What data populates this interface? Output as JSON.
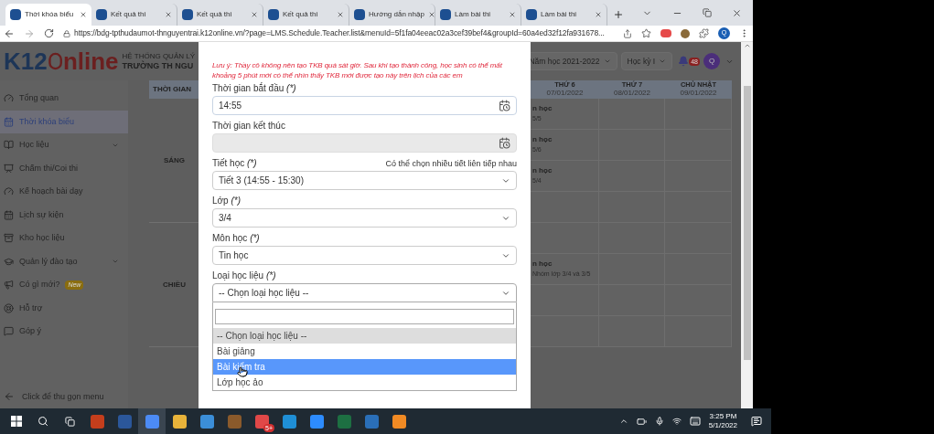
{
  "browser": {
    "tabs": [
      {
        "title": "Thời khóa biểu",
        "selected": true
      },
      {
        "title": "Kết quả thi",
        "selected": false
      },
      {
        "title": "Kết quả thi",
        "selected": false
      },
      {
        "title": "Kết quả thi",
        "selected": false
      },
      {
        "title": "Hướng dẫn nhập",
        "selected": false
      },
      {
        "title": "Làm bài thi",
        "selected": false
      },
      {
        "title": "Làm bài thi",
        "selected": false
      }
    ],
    "url": "https://bdg-tpthudaumot-thnguyentrai.k12online.vn/?page=LMS.Schedule.Teacher.list&menuId=5f1fa04eeac02a3cef39bef4&groupId=60a4ed32f12fa931678...",
    "profile": "Q"
  },
  "header": {
    "logo_left": "K12",
    "logo_right": "nline",
    "system_title": "HỆ THỐNG QUẢN LÝ",
    "school": "TRƯỜNG TH NGU",
    "year": "Năm học 2021-2022",
    "term": "Học kỳ I",
    "notifications": "48",
    "avatar": "Q"
  },
  "sidebar": {
    "items": [
      {
        "label": "Tổng quan",
        "selected": false,
        "kind": "link"
      },
      {
        "label": "Thời khóa biểu",
        "selected": true,
        "kind": "link"
      },
      {
        "label": "Học liệu",
        "selected": false,
        "kind": "group"
      },
      {
        "label": "Chấm thi/Coi thi",
        "selected": false,
        "kind": "link"
      },
      {
        "label": "Kế hoạch bài dạy",
        "selected": false,
        "kind": "link"
      },
      {
        "label": "Lịch sự kiện",
        "selected": false,
        "kind": "link"
      },
      {
        "label": "Kho học liệu",
        "selected": false,
        "kind": "link"
      },
      {
        "label": "Quản lý đào tạo",
        "selected": false,
        "kind": "group"
      },
      {
        "label": "Có gì mới?",
        "selected": false,
        "kind": "link",
        "badge": "New"
      },
      {
        "label": "Hỗ trợ",
        "selected": false,
        "kind": "link"
      },
      {
        "label": "Góp ý",
        "selected": false,
        "kind": "link"
      }
    ],
    "collapse": "Click để thu gọn menu"
  },
  "schedule": {
    "time_header": "THỜI GIAN",
    "periods": [
      "SÁNG",
      "CHIỀU"
    ],
    "days": [
      {
        "day": "THỨ 6",
        "date": "07/01/2022"
      },
      {
        "day": "THỨ 7",
        "date": "08/01/2022"
      },
      {
        "day": "CHỦ NHẬT",
        "date": "09/01/2022"
      }
    ],
    "rows": [
      [
        {
          "title": "n học",
          "sub": "5/5"
        },
        {},
        {}
      ],
      [
        {
          "title": "n học",
          "sub": "5/6"
        },
        {},
        {}
      ],
      [
        {
          "title": "n học",
          "sub": "5/4"
        },
        {},
        {}
      ],
      [
        {},
        {},
        {}
      ],
      [
        {},
        {},
        {}
      ],
      [
        {
          "title": "n học",
          "sub": "Nhóm lớp 3/4 và 3/5"
        },
        {},
        {}
      ],
      [
        {},
        {},
        {}
      ],
      [
        {},
        {},
        {}
      ]
    ]
  },
  "modal": {
    "notice": "Lưu ý: Thầy cô không nên tạo TKB quá sát giờ. Sau khi tạo thành công, học sinh có thể mất khoảng 5 phút mới có thể nhìn thấy TKB mới được tạo này trên lịch của các em",
    "fields": [
      {
        "kind": "date",
        "label": "Thời gian bắt đầu",
        "required": "(*)",
        "value": "14:55",
        "disabled": false
      },
      {
        "kind": "date",
        "label": "Thời gian kết thúc",
        "disabled": true
      },
      {
        "kind": "select",
        "label": "Tiết học",
        "required": "(*)",
        "hint": "Có thể chọn nhiều tiết liên tiếp nhau",
        "value": "Tiết 3 (14:55 - 15:30)"
      },
      {
        "kind": "select",
        "label": "Lớp",
        "required": "(*)",
        "value": "3/4"
      },
      {
        "kind": "select",
        "label": "Môn học",
        "required": "(*)",
        "value": "Tin học"
      },
      {
        "kind": "select",
        "label": "Loại học liệu",
        "required": "(*)",
        "value": "-- Chọn loại học liệu --",
        "expanded": true,
        "options": [
          {
            "label": "-- Chọn loại học liệu --",
            "selected": true,
            "highlighted": false
          },
          {
            "label": "Bài giảng",
            "selected": false,
            "highlighted": false
          },
          {
            "label": "Bài kiểm tra",
            "selected": false,
            "highlighted": true
          },
          {
            "label": "Lớp học ảo",
            "selected": false,
            "highlighted": false
          }
        ]
      }
    ]
  },
  "taskbar": {
    "app_badge": "5+",
    "time": "3:25 PM",
    "date": "5/1/2022"
  }
}
